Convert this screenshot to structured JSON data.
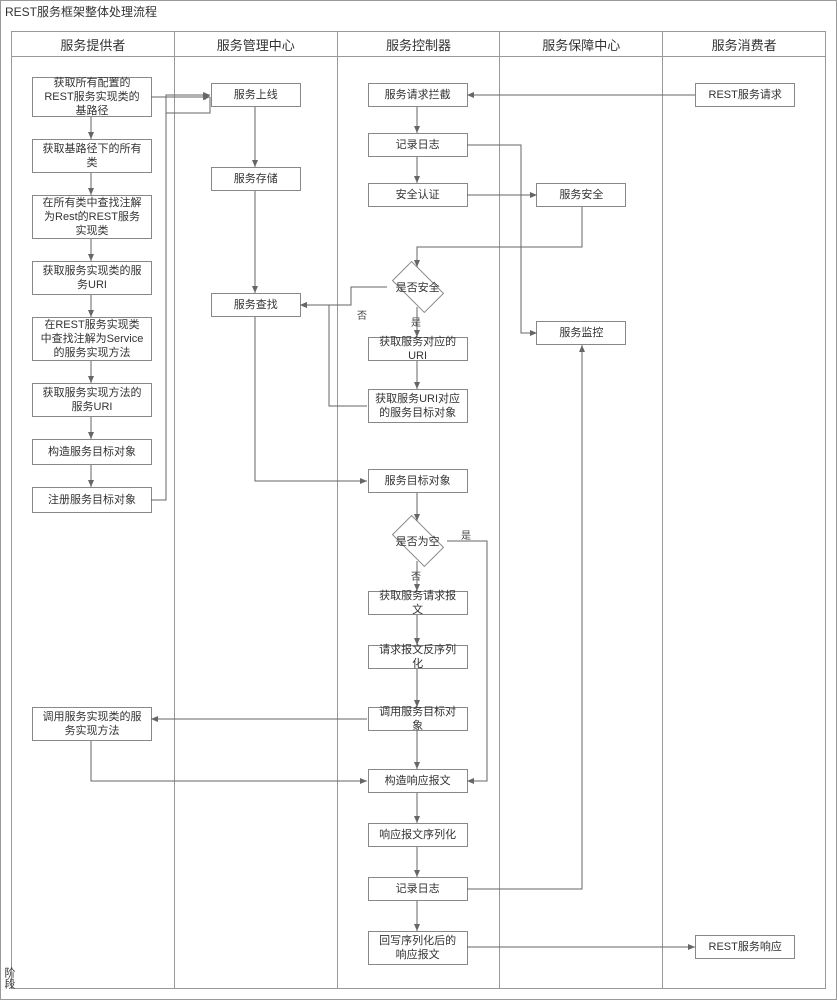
{
  "title": "REST服务框架整体处理流程",
  "sideLabel": "阶段",
  "lanes": {
    "provider": "服务提供者",
    "mgmt": "服务管理中心",
    "ctrl": "服务控制器",
    "guard": "服务保障中心",
    "consumer": "服务消费者"
  },
  "providerBoxes": {
    "p1": "获取所有配置的REST服务实现类的基路径",
    "p2": "获取基路径下的所有类",
    "p3": "在所有类中查找注解为Rest的REST服务实现类",
    "p4": "获取服务实现类的服务URI",
    "p5": "在REST服务实现类中查找注解为Service的服务实现方法",
    "p6": "获取服务实现方法的服务URI",
    "p7": "构造服务目标对象",
    "p8": "注册服务目标对象",
    "p9": "调用服务实现类的服务实现方法"
  },
  "mgmtBoxes": {
    "m1": "服务上线",
    "m2": "服务存储",
    "m3": "服务查找"
  },
  "ctrlBoxes": {
    "c1": "服务请求拦截",
    "c2": "记录日志",
    "c3": "安全认证",
    "c4": "获取服务对应的URI",
    "c5": "获取服务URI对应的服务目标对象",
    "c6": "服务目标对象",
    "c7": "获取服务请求报文",
    "c8": "请求报文反序列化",
    "c9": "调用服务目标对象",
    "c10": "构造响应报文",
    "c11": "响应报文序列化",
    "c12": "记录日志",
    "c13": "回写序列化后的响应报文"
  },
  "guardBoxes": {
    "g1": "服务安全",
    "g2": "服务监控"
  },
  "consumerBoxes": {
    "u1": "REST服务请求",
    "u2": "REST服务响应"
  },
  "decisions": {
    "d1": "是否安全",
    "d2": "是否为空"
  },
  "labels": {
    "yes": "是",
    "no": "否",
    "noSafe": "否"
  }
}
